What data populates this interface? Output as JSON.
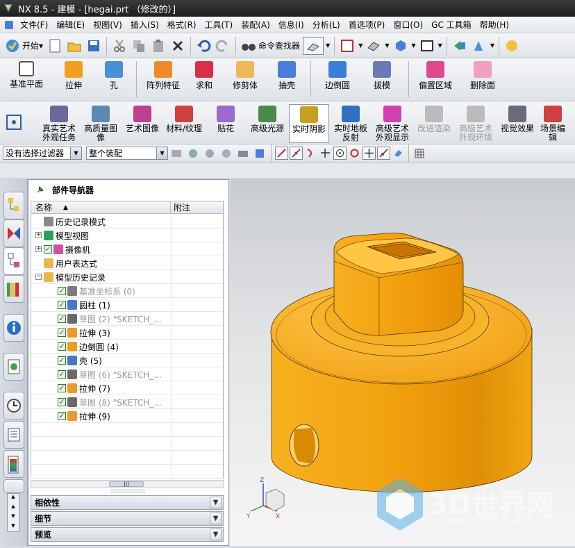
{
  "title": "NX 8.5 - 建模 - [hegai.prt （修改的）]",
  "menu": [
    "文件(F)",
    "编辑(E)",
    "视图(V)",
    "插入(S)",
    "格式(R)",
    "工具(T)",
    "装配(A)",
    "信息(I)",
    "分析(L)",
    "首选项(P)",
    "窗口(O)",
    "GC 工具箱",
    "帮助(H)"
  ],
  "toolbar1": {
    "start_label": "开始▾",
    "finder_label": "命令查找器"
  },
  "toolbar2": [
    {
      "label": "基准平面",
      "icon": "datum-plane-icon",
      "color": "#ffffff"
    },
    {
      "label": "拉伸",
      "icon": "extrude-icon",
      "color": "#f0a020"
    },
    {
      "label": "孔",
      "icon": "hole-icon",
      "color": "#4a90d9"
    },
    {
      "label": "阵列特征",
      "icon": "pattern-feature-icon",
      "color": "#ee8a2a"
    },
    {
      "label": "求和",
      "icon": "unite-icon",
      "color": "#d9304a"
    },
    {
      "label": "修剪体",
      "icon": "trim-body-icon",
      "color": "#f0b85a"
    },
    {
      "label": "抽壳",
      "icon": "shell-icon",
      "color": "#4a7ed9"
    },
    {
      "label": "边倒圆",
      "icon": "edge-blend-icon",
      "color": "#3b7fd9"
    },
    {
      "label": "拔模",
      "icon": "draft-icon",
      "color": "#6a7ab8"
    },
    {
      "label": "偏置区域",
      "icon": "offset-region-icon",
      "color": "#e04a8a"
    },
    {
      "label": "删除面",
      "icon": "delete-face-icon",
      "color": "#f0a0c0"
    }
  ],
  "toolbar3": [
    {
      "label": "真实艺术外观任务",
      "icon": "true-studio-icon",
      "color": "#6a6a9a",
      "state": "normal"
    },
    {
      "label": "高质量图像",
      "icon": "high-quality-image-icon",
      "color": "#5a8ab0",
      "state": "normal"
    },
    {
      "label": "艺术图像",
      "icon": "artistic-image-icon",
      "color": "#c04090",
      "state": "normal"
    },
    {
      "label": "材料/纹理",
      "icon": "materials-textures-icon",
      "color": "#d04040",
      "state": "normal"
    },
    {
      "label": "贴花",
      "icon": "decal-icon",
      "color": "#9a6acc",
      "state": "normal"
    },
    {
      "label": "高级光源",
      "icon": "advanced-lights-icon",
      "color": "#4a8a4a",
      "state": "normal"
    },
    {
      "label": "实时阴影",
      "icon": "realtime-shadows-icon",
      "color": "#c8a020",
      "state": "on"
    },
    {
      "label": "实时地板反射",
      "icon": "floor-reflection-icon",
      "color": "#3070c0",
      "state": "normal"
    },
    {
      "label": "高级艺术外观显示",
      "icon": "advanced-studio-display-icon",
      "color": "#d040b0",
      "state": "normal"
    },
    {
      "label": "改进渲染",
      "icon": "improve-render-icon",
      "color": "#999999",
      "state": "disabled"
    },
    {
      "label": "高级艺术外观环境",
      "icon": "studio-environment-icon",
      "color": "#999999",
      "state": "disabled"
    },
    {
      "label": "视觉效果",
      "icon": "visual-effects-icon",
      "color": "#6a6a7a",
      "state": "normal"
    },
    {
      "label": "场景编辑",
      "icon": "scene-edit-icon",
      "color": "#d04040",
      "state": "normal"
    }
  ],
  "selection": {
    "filter": "没有选择过滤器",
    "scope": "整个装配"
  },
  "navigator": {
    "title": "部件导航器",
    "col_name": "名称",
    "col_note": "附注",
    "rows": [
      {
        "label": "历史记录模式",
        "level": 0,
        "expand": "",
        "check": false,
        "icon": "clock-icon",
        "icolor": "#8a8a8a",
        "gray": false
      },
      {
        "label": "模型视图",
        "level": 0,
        "expand": "+",
        "check": false,
        "icon": "model-views-icon",
        "icolor": "#2e9e5e",
        "gray": false
      },
      {
        "label": "摄像机",
        "level": 0,
        "expand": "+",
        "check": true,
        "icon": "camera-icon",
        "icolor": "#d04fa0",
        "gray": false
      },
      {
        "label": "用户表达式",
        "level": 0,
        "expand": "",
        "check": false,
        "icon": "folder-icon",
        "icolor": "#e8b84a",
        "gray": false
      },
      {
        "label": "模型历史记录",
        "level": 0,
        "expand": "−",
        "check": false,
        "icon": "folder-icon",
        "icolor": "#e8b84a",
        "gray": false
      },
      {
        "label": "基准坐标系 (0)",
        "level": 1,
        "expand": "",
        "check": true,
        "icon": "datum-csys-icon",
        "icolor": "#7a7a7a",
        "gray": true
      },
      {
        "label": "圆柱 (1)",
        "level": 1,
        "expand": "",
        "check": true,
        "icon": "cylinder-icon",
        "icolor": "#4a78c8",
        "gray": false
      },
      {
        "label": "草图 (2) \"SKETCH_...",
        "level": 1,
        "expand": "",
        "check": true,
        "icon": "sketch-icon",
        "icolor": "#6a6a6a",
        "gray": true
      },
      {
        "label": "拉伸 (3)",
        "level": 1,
        "expand": "",
        "check": true,
        "icon": "extrude-icon",
        "icolor": "#e89a2a",
        "gray": false
      },
      {
        "label": "边倒圆 (4)",
        "level": 1,
        "expand": "",
        "check": true,
        "icon": "edge-blend-icon",
        "icolor": "#e8a020",
        "gray": false
      },
      {
        "label": "壳 (5)",
        "level": 1,
        "expand": "",
        "check": true,
        "icon": "shell-icon",
        "icolor": "#4a78c8",
        "gray": false
      },
      {
        "label": "草图 (6) \"SKETCH_...",
        "level": 1,
        "expand": "",
        "check": true,
        "icon": "sketch-icon",
        "icolor": "#6a6a6a",
        "gray": true
      },
      {
        "label": "拉伸 (7)",
        "level": 1,
        "expand": "",
        "check": true,
        "icon": "extrude-icon",
        "icolor": "#e89a2a",
        "gray": false
      },
      {
        "label": "草图 (8) \"SKETCH_...",
        "level": 1,
        "expand": "",
        "check": true,
        "icon": "sketch-icon",
        "icolor": "#6a6a6a",
        "gray": true
      },
      {
        "label": "拉伸 (9)",
        "level": 1,
        "expand": "",
        "check": true,
        "icon": "extrude-icon",
        "icolor": "#e89a2a",
        "gray": false
      }
    ],
    "panels": [
      "相依性",
      "细节",
      "预览"
    ]
  },
  "axes": {
    "x": "X",
    "y": "Y",
    "z": "Z"
  },
  "watermark": {
    "brand": "3D世界网",
    "url": "WWW.3DSJW.COM"
  },
  "colors": {
    "part": "#f2a41a",
    "part_dark": "#c87a05",
    "part_light": "#ffc84a"
  }
}
